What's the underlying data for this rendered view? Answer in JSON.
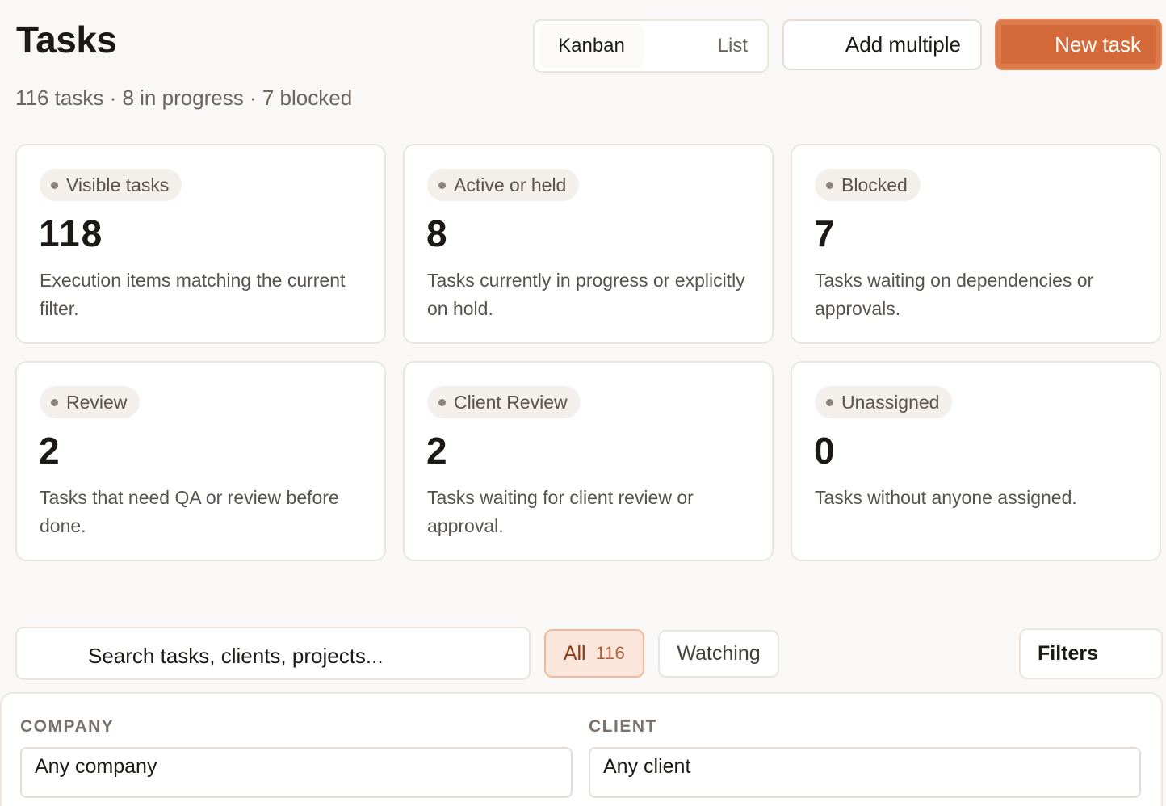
{
  "header": {
    "title": "Tasks",
    "subtitle": "116 tasks · 8 in progress · 7 blocked",
    "view_toggle": {
      "kanban_label": "Kanban",
      "list_label": "List",
      "active": "Kanban"
    },
    "add_multiple_label": "Add multiple",
    "new_task_label": "New task"
  },
  "stats": [
    {
      "label": "Visible tasks",
      "value": "118",
      "description": "Execution items matching the current filter."
    },
    {
      "label": "Active or held",
      "value": "8",
      "description": "Tasks currently in progress or explicitly on hold."
    },
    {
      "label": "Blocked",
      "value": "7",
      "description": "Tasks waiting on dependencies or approvals."
    },
    {
      "label": "Review",
      "value": "2",
      "description": "Tasks that need QA or review before done."
    },
    {
      "label": "Client Review",
      "value": "2",
      "description": "Tasks waiting for client review or approval."
    },
    {
      "label": "Unassigned",
      "value": "0",
      "description": "Tasks without anyone assigned."
    }
  ],
  "toolbar": {
    "search_placeholder": "Search tasks, clients, projects...",
    "all_label": "All",
    "all_count": "116",
    "watching_label": "Watching",
    "filters_label": "Filters"
  },
  "filters": {
    "company_label": "COMPANY",
    "company_value": "Any company",
    "client_label": "CLIENT",
    "client_value": "Any client"
  },
  "colors": {
    "accent": "#d46a3a",
    "accent_soft": "#fbe6dc",
    "background": "#faf8f6"
  }
}
